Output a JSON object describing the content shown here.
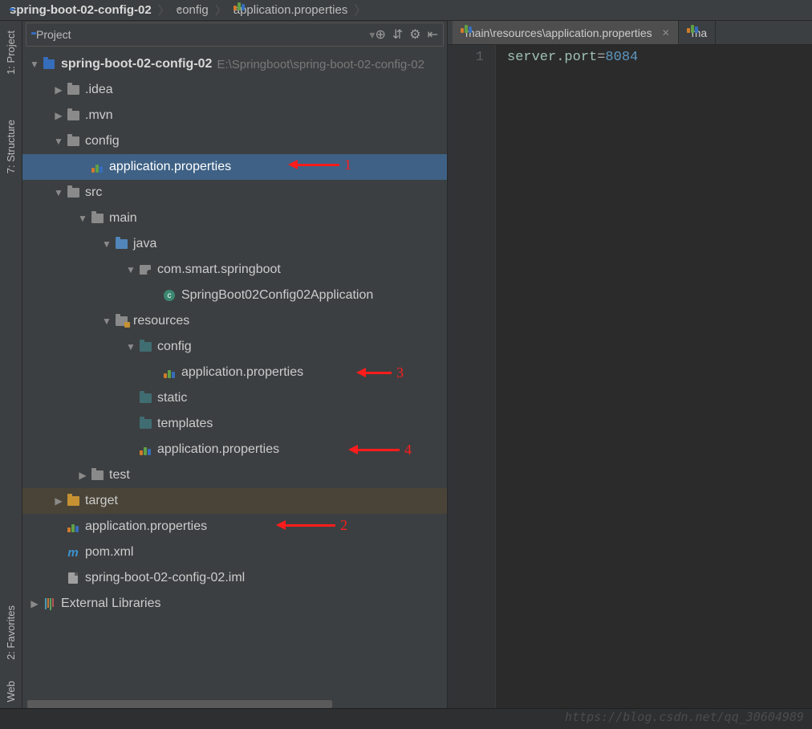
{
  "breadcrumb": {
    "items": [
      {
        "label": "spring-boot-02-config-02",
        "icon": "project"
      },
      {
        "label": "config",
        "icon": "folder"
      },
      {
        "label": "application.properties",
        "icon": "prop"
      }
    ]
  },
  "left_gutter": {
    "project": "1: Project",
    "structure": "7: Structure",
    "favorites": "2: Favorites",
    "web": "Web"
  },
  "project_panel": {
    "title": "Project",
    "root": {
      "label": "spring-boot-02-config-02",
      "path": "E:\\Springboot\\spring-boot-02-config-02"
    }
  },
  "tree": {
    "idea": ".idea",
    "mvn": ".mvn",
    "config": "config",
    "config_app": "application.properties",
    "src": "src",
    "main": "main",
    "java": "java",
    "pkg": "com.smart.springboot",
    "cls": "SpringBoot02Config02Application",
    "resources": "resources",
    "res_config": "config",
    "res_config_app": "application.properties",
    "static": "static",
    "templates": "templates",
    "res_app": "application.properties",
    "test": "test",
    "target": "target",
    "root_app": "application.properties",
    "pom": "pom.xml",
    "iml": "spring-boot-02-config-02.iml",
    "ext": "External Libraries"
  },
  "editor": {
    "tabs": [
      {
        "label": "main\\resources\\application.properties"
      },
      {
        "label": "ma"
      }
    ],
    "line_number": "1",
    "code": {
      "key": "server.port",
      "op": "=",
      "value": "8084"
    }
  },
  "watermark": "https://blog.csdn.net/qq_30604989",
  "annotations": {
    "n1": "1",
    "n2": "2",
    "n3": "3",
    "n4": "4"
  }
}
